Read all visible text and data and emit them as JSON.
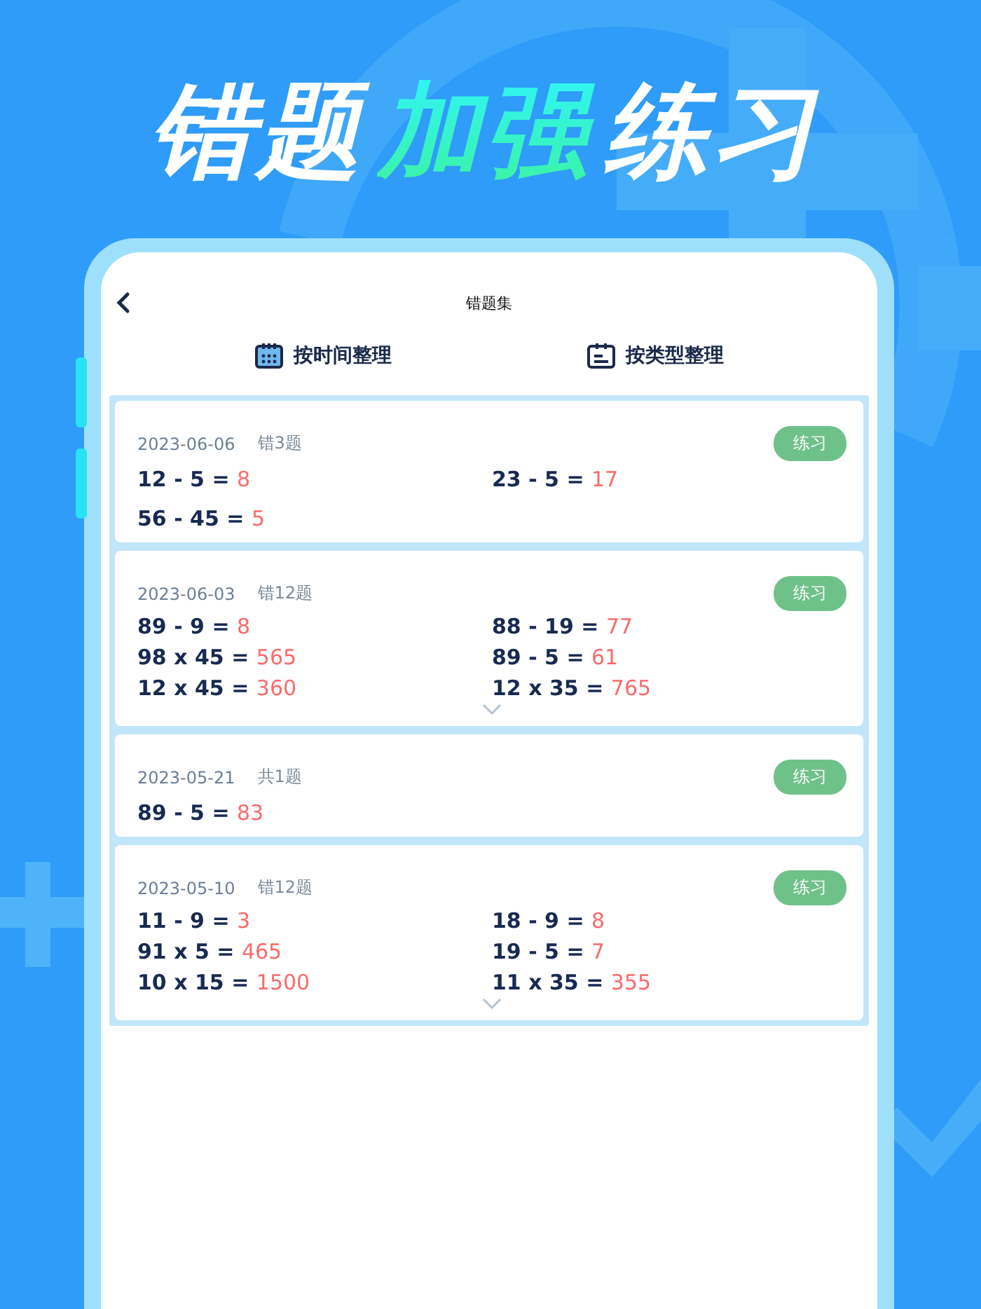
{
  "headline": [
    {
      "text": "错题",
      "highlight": false
    },
    {
      "text": "加强",
      "highlight": true
    },
    {
      "text": "练习",
      "highlight": false
    }
  ],
  "screen": {
    "title": "错题集",
    "tabs": [
      {
        "label": "按时间整理"
      },
      {
        "label": "按类型整理"
      }
    ],
    "cards": [
      {
        "date": "2023-06-06",
        "count": "错3题",
        "button": "练习",
        "has_more": false,
        "problems": [
          {
            "q": "12 - 5 =",
            "a": "8"
          },
          {
            "q": "23 - 5 =",
            "a": "17"
          },
          {
            "q": "56 - 45 =",
            "a": "5"
          }
        ]
      },
      {
        "date": "2023-06-03",
        "count": "错12题",
        "button": "练习",
        "has_more": true,
        "problems": [
          {
            "q": "89 - 9 =",
            "a": "8"
          },
          {
            "q": "88 - 19 =",
            "a": "77"
          },
          {
            "q": "98 x 45 =",
            "a": "565"
          },
          {
            "q": "89 - 5 =",
            "a": "61"
          },
          {
            "q": "12 x 45 =",
            "a": "360"
          },
          {
            "q": "12 x 35 =",
            "a": "765"
          }
        ]
      },
      {
        "date": "2023-05-21",
        "count": "共1题",
        "button": "练习",
        "has_more": false,
        "problems": [
          {
            "q": "89 - 5 =",
            "a": "83"
          }
        ]
      },
      {
        "date": "2023-05-10",
        "count": "错12题",
        "button": "练习",
        "has_more": true,
        "problems": [
          {
            "q": "11 - 9 =",
            "a": "3"
          },
          {
            "q": "18 - 9 =",
            "a": "8"
          },
          {
            "q": "91 x 5 =",
            "a": "465"
          },
          {
            "q": "19 - 5 =",
            "a": "7"
          },
          {
            "q": "10 x 15 =",
            "a": "1500"
          },
          {
            "q": "11 x 35 =",
            "a": "355"
          }
        ]
      }
    ]
  }
}
